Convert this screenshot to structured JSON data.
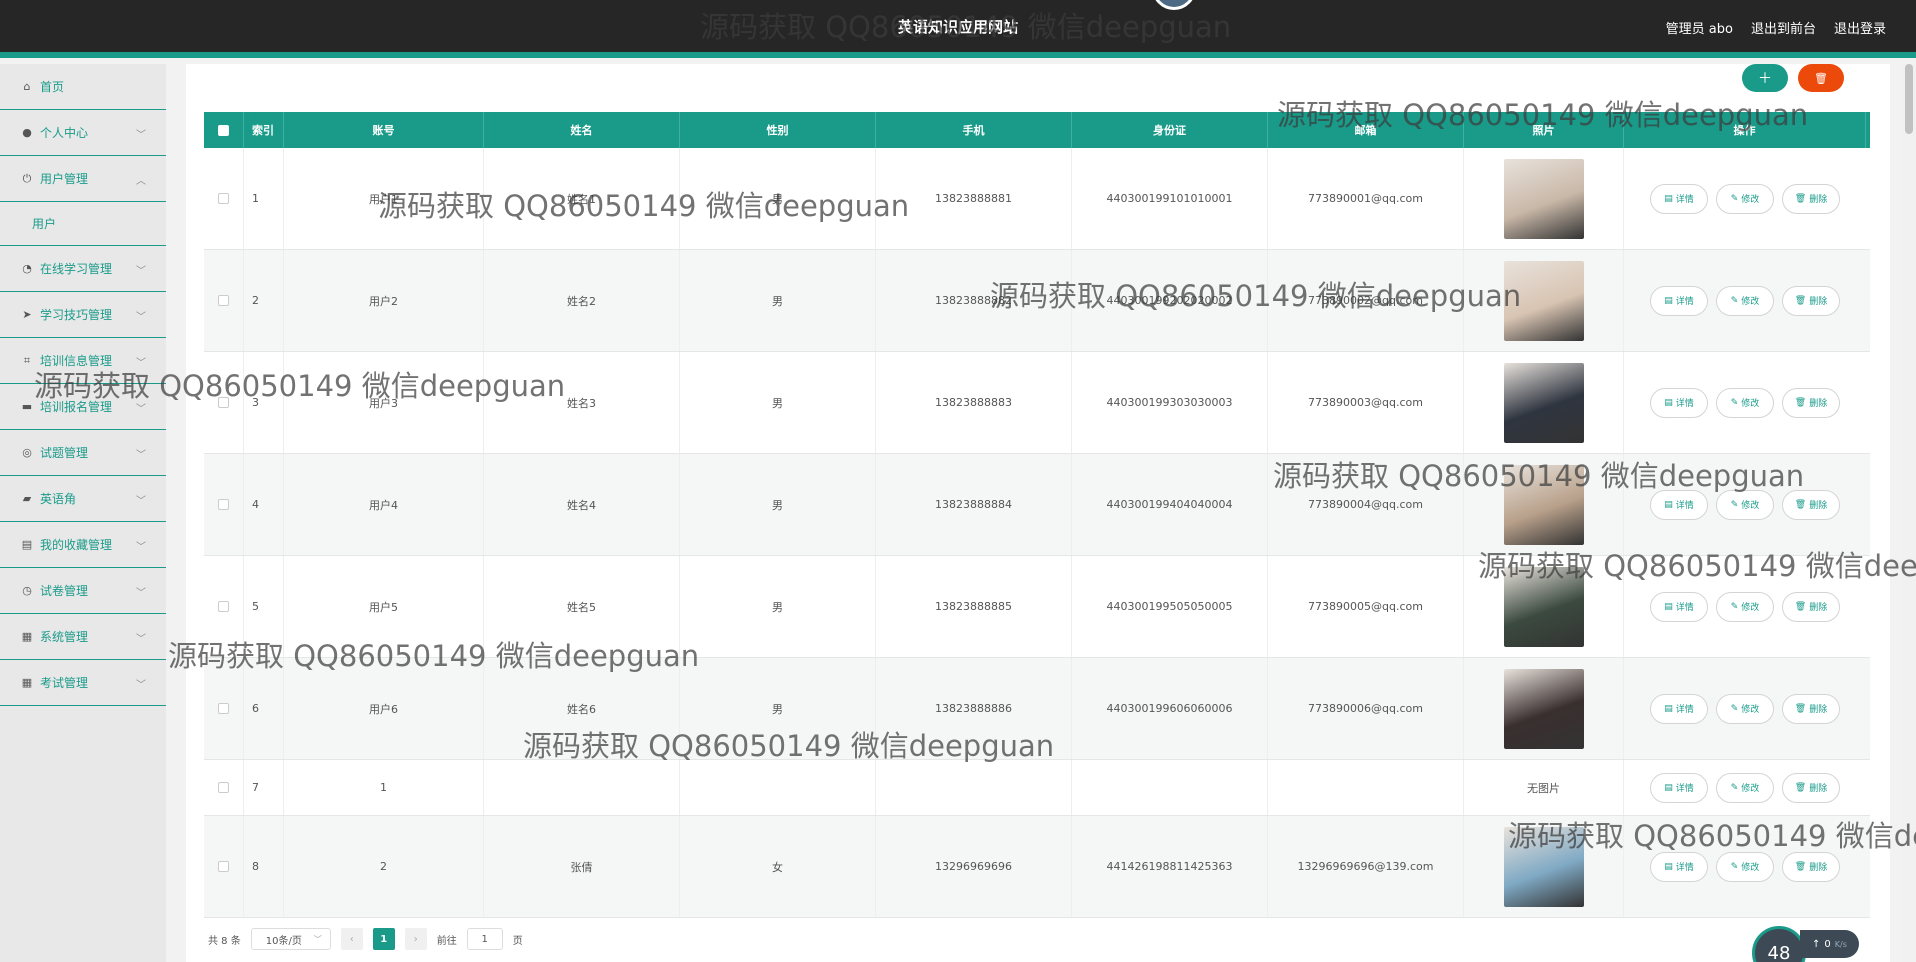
{
  "header": {
    "site_title": "英语知识应用网站",
    "user_label": "管理员 abo",
    "to_frontend": "退出到前台",
    "logout": "退出登录"
  },
  "sidebar": {
    "items": [
      {
        "label": "首页",
        "icon": "home-icon"
      },
      {
        "label": "个人中心",
        "icon": "user-icon"
      },
      {
        "label": "用户管理",
        "icon": "power-icon"
      },
      {
        "label": "在线学习管理",
        "icon": "clock-icon"
      },
      {
        "label": "学习技巧管理",
        "icon": "send-icon"
      },
      {
        "label": "培训信息管理",
        "icon": "crop-icon"
      },
      {
        "label": "培训报名管理",
        "icon": "chat-icon"
      },
      {
        "label": "试题管理",
        "icon": "globe-icon"
      },
      {
        "label": "英语角",
        "icon": "briefcase-icon"
      },
      {
        "label": "我的收藏管理",
        "icon": "drive-icon"
      },
      {
        "label": "试卷管理",
        "icon": "clock-icon"
      },
      {
        "label": "系统管理",
        "icon": "clipboard-icon"
      },
      {
        "label": "考试管理",
        "icon": "clipboard-icon"
      }
    ],
    "sub_user": "用户"
  },
  "table": {
    "headers": [
      "索引",
      "账号",
      "姓名",
      "性别",
      "手机",
      "身份证",
      "邮箱",
      "照片",
      "操作"
    ],
    "rows": [
      {
        "idx": "1",
        "account": "用户1",
        "name": "姓名1",
        "sex": "男",
        "phone": "13823888881",
        "idcard": "440300199101010001",
        "email": "773890001@qq.com",
        "photo": "avatar"
      },
      {
        "idx": "2",
        "account": "用户2",
        "name": "姓名2",
        "sex": "男",
        "phone": "13823888882",
        "idcard": "440300199202020002",
        "email": "773890002@qq.com",
        "photo": "avatar"
      },
      {
        "idx": "3",
        "account": "用户3",
        "name": "姓名3",
        "sex": "男",
        "phone": "13823888883",
        "idcard": "440300199303030003",
        "email": "773890003@qq.com",
        "photo": "avatar"
      },
      {
        "idx": "4",
        "account": "用户4",
        "name": "姓名4",
        "sex": "男",
        "phone": "13823888884",
        "idcard": "440300199404040004",
        "email": "773890004@qq.com",
        "photo": "avatar"
      },
      {
        "idx": "5",
        "account": "用户5",
        "name": "姓名5",
        "sex": "男",
        "phone": "13823888885",
        "idcard": "440300199505050005",
        "email": "773890005@qq.com",
        "photo": "avatar"
      },
      {
        "idx": "6",
        "account": "用户6",
        "name": "姓名6",
        "sex": "男",
        "phone": "13823888886",
        "idcard": "440300199606060006",
        "email": "773890006@qq.com",
        "photo": "avatar"
      },
      {
        "idx": "7",
        "account": "1",
        "name": "",
        "sex": "",
        "phone": "",
        "idcard": "",
        "email": "",
        "photo": "none"
      },
      {
        "idx": "8",
        "account": "2",
        "name": "张倩",
        "sex": "女",
        "phone": "13296969696",
        "idcard": "441426198811425363",
        "email": "13296969696@139.com",
        "photo": "avatar"
      }
    ],
    "no_photo_text": "无图片",
    "actions": {
      "detail": "详情",
      "edit": "修改",
      "delete": "删除"
    }
  },
  "pagination": {
    "total": "共 8 条",
    "page_size": "10条/页",
    "current_page": "1",
    "goto_label": "前往",
    "goto_value": "1",
    "page_unit": "页"
  },
  "speed_widget": {
    "value": "48",
    "rate": "0",
    "unit": "K/s"
  },
  "watermark": "源码获取 QQ86050149 微信deepguan",
  "colors": {
    "accent": "#1a9b8a",
    "danger": "#ec4a0b",
    "topbar": "#262626"
  }
}
